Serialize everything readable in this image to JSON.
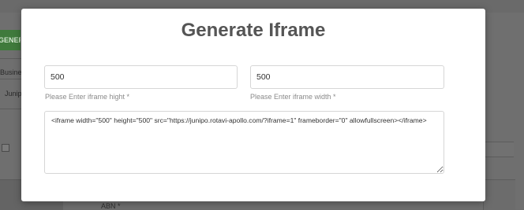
{
  "background": {
    "generate_button_label": "GENERATE",
    "business_label": "Business",
    "junipo_label": "Junipo",
    "abn_label": "ABN *"
  },
  "modal": {
    "title": "Generate Iframe",
    "height_field": {
      "value": "500",
      "hint": "Please Enter iframe hight *"
    },
    "width_field": {
      "value": "500",
      "hint": "Please Enter iframe width *"
    },
    "iframe_code": "<iframe width=\"500\" height=\"500\" src=\"https://junipo.rotavi-apollo.com/?iframe=1\" frameborder=\"0\" allowfullscreen></iframe>"
  },
  "colors": {
    "overlay": "#6f6f6f",
    "modal_background": "#ffffff",
    "title_text": "#555555",
    "hint_text": "#8a8a8a",
    "accent_green": "#3f7a3c"
  }
}
